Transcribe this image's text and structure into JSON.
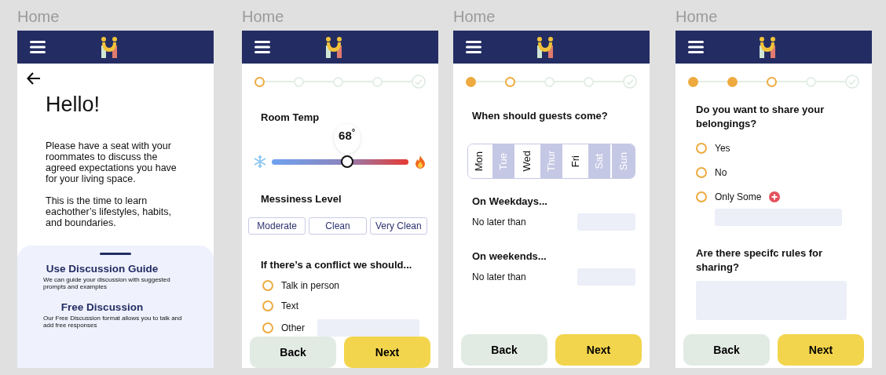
{
  "screens": [
    {
      "kind": "intro",
      "label": "Home",
      "title": "Hello!",
      "paragraphs": [
        "Please  have a seat with your roommates to discuss the agreed expectations you have for your living space.",
        "This is the time to learn eachother’s lifestyles, habits, and boundaries."
      ],
      "options": [
        {
          "title": "Use Discussion Guide",
          "description": "We can guide your discussion with suggested prompts and examples"
        },
        {
          "title": "Free Discussion",
          "description": "Our Free Discussion format allows you to talk and add free responses"
        }
      ]
    },
    {
      "kind": "form",
      "label": "Home",
      "steps": [
        {
          "kind": "dot",
          "done": false,
          "current": true
        },
        {
          "kind": "dot",
          "done": false,
          "current": false
        },
        {
          "kind": "dot",
          "done": false,
          "current": false
        },
        {
          "kind": "dot",
          "done": false,
          "current": false
        },
        {
          "kind": "check"
        }
      ],
      "sections": [
        {
          "kind": "slider",
          "title": "Room Temp",
          "reading": "68$^{°}$",
          "level": 0.55
        },
        {
          "kind": "choices",
          "title": "Messiness Level",
          "options": [
            {
              "label": "Moderate",
              "selected": false
            },
            {
              "label": "Clean",
              "selected": false
            },
            {
              "label": "Very Clean",
              "selected": false
            }
          ]
        },
        {
          "kind": "radios",
          "title": "If there’s a conflict we should...",
          "options": [
            {
              "label": "Talk in person",
              "selected": false
            },
            {
              "label": "Text",
              "selected": false
            },
            {
              "label": "Other",
              "selected": false,
              "field": true
            }
          ]
        }
      ],
      "buttons": [
        "Back",
        "Next"
      ]
    },
    {
      "kind": "form",
      "label": "Home",
      "steps": [
        {
          "kind": "dot",
          "done": true,
          "current": false
        },
        {
          "kind": "dot",
          "done": false,
          "current": true
        },
        {
          "kind": "dot",
          "done": false,
          "current": false
        },
        {
          "kind": "dot",
          "done": false,
          "current": false
        },
        {
          "kind": "check"
        }
      ],
      "sections": [
        {
          "kind": "days",
          "title": "When should guests come?",
          "days": [
            {
              "label": "Mon",
              "selected": true
            },
            {
              "label": "Tue",
              "selected": false
            },
            {
              "label": "Wed",
              "selected": true
            },
            {
              "label": "Thur",
              "selected": false
            },
            {
              "label": "Fri",
              "selected": true
            },
            {
              "label": "Sat",
              "selected": false
            },
            {
              "label": "Sun",
              "selected": false
            }
          ]
        },
        {
          "kind": "time",
          "title": "On Weekdays...",
          "label": "No later than"
        },
        {
          "kind": "time",
          "title": "On weekends...",
          "label": "No later than"
        }
      ],
      "buttons": [
        "Back",
        "Next"
      ]
    },
    {
      "kind": "form",
      "label": "Home",
      "steps": [
        {
          "kind": "dot",
          "done": true,
          "current": false
        },
        {
          "kind": "dot",
          "done": true,
          "current": false
        },
        {
          "kind": "dot",
          "done": false,
          "current": true
        },
        {
          "kind": "dot",
          "done": false,
          "current": false
        },
        {
          "kind": "check"
        }
      ],
      "sections": [
        {
          "kind": "radios",
          "title": "Do you want to share your belongings?",
          "options": [
            {
              "label": "Yes",
              "selected": false
            },
            {
              "label": "No",
              "selected": false
            },
            {
              "label": "Only Some",
              "selected": false,
              "add": true,
              "field": true
            }
          ]
        },
        {
          "kind": "textarea",
          "title": "Are there specifc rules for sharing?"
        }
      ],
      "buttons": [
        "Back",
        "Next"
      ]
    }
  ]
}
